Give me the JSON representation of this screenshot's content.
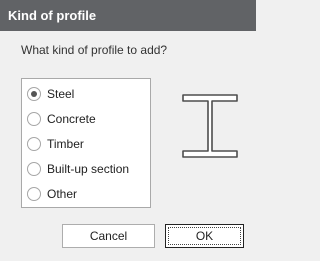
{
  "dialog": {
    "title": "Kind of profile",
    "prompt": "What kind of profile to add?",
    "options": [
      {
        "label": "Steel",
        "selected": true
      },
      {
        "label": "Concrete",
        "selected": false
      },
      {
        "label": "Timber",
        "selected": false
      },
      {
        "label": "Built-up section",
        "selected": false
      },
      {
        "label": "Other",
        "selected": false
      }
    ],
    "preview_icon": "i-beam-icon",
    "buttons": {
      "cancel": "Cancel",
      "ok": "OK"
    }
  },
  "colors": {
    "titlebar": "#616366",
    "background": "#f0f0f0",
    "icon_stroke": "#4d4d4d"
  }
}
